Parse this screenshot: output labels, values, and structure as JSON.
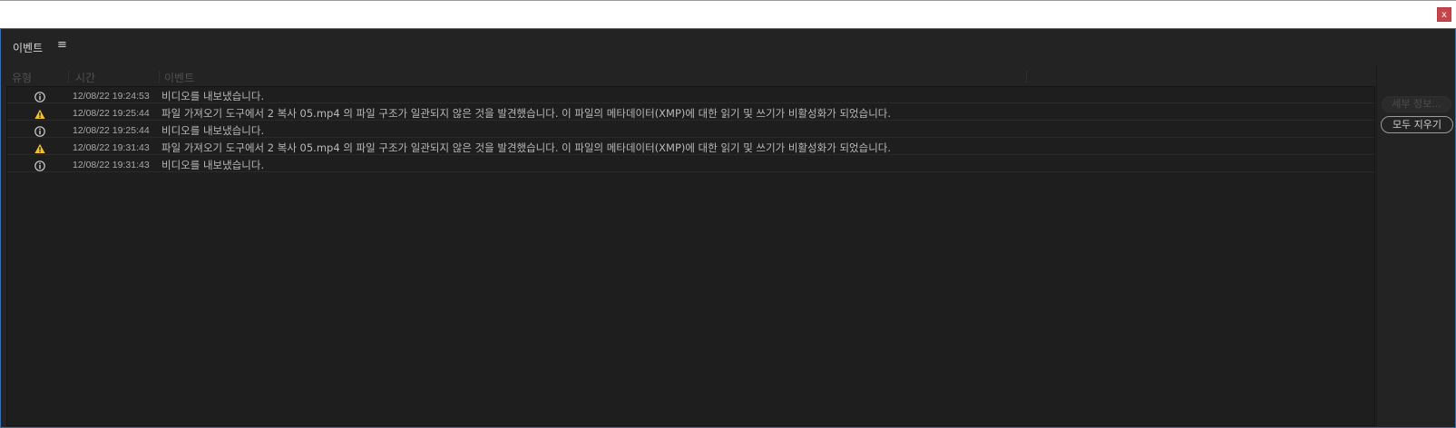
{
  "window": {
    "close_label": "x"
  },
  "panel": {
    "title": "이벤트",
    "menu_icon": "≡"
  },
  "columns": {
    "type": "유형",
    "time": "시간",
    "event": "이벤트"
  },
  "buttons": {
    "details": "세부 정보...",
    "clear_all": "모두 지우기"
  },
  "colors": {
    "warning": "#f2c12e",
    "info": "#d0d0d0",
    "accent_border": "#3c6fb0",
    "close": "#c8444a"
  },
  "events": [
    {
      "icon": "info-icon",
      "time": "12/08/22 19:24:53",
      "message": "비디오를 내보냈습니다."
    },
    {
      "icon": "warning-icon",
      "time": "12/08/22 19:25:44",
      "message": "파일 가져오기 도구에서 2 복사 05.mp4 의 파일 구조가 일관되지 않은 것을 발견했습니다. 이 파일의 메타데이터(XMP)에 대한 읽기 및 쓰기가 비활성화가 되었습니다."
    },
    {
      "icon": "info-icon",
      "time": "12/08/22 19:25:44",
      "message": "비디오를 내보냈습니다."
    },
    {
      "icon": "warning-icon",
      "time": "12/08/22 19:31:43",
      "message": "파일 가져오기 도구에서 2 복사 05.mp4 의 파일 구조가 일관되지 않은 것을 발견했습니다. 이 파일의 메타데이터(XMP)에 대한 읽기 및 쓰기가 비활성화가 되었습니다."
    },
    {
      "icon": "info-icon",
      "time": "12/08/22 19:31:43",
      "message": "비디오를 내보냈습니다."
    }
  ]
}
